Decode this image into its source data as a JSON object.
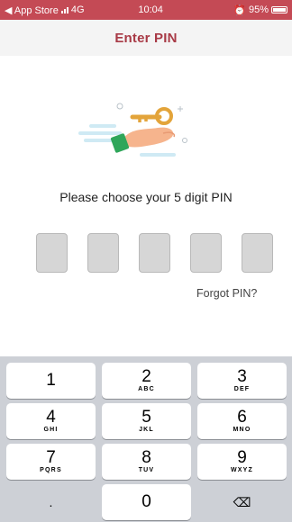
{
  "status_bar": {
    "back_app": "◀ App Store",
    "network": "4G",
    "time": "10:04",
    "battery": "95%"
  },
  "header": {
    "title": "Enter PIN"
  },
  "illustration": {
    "icon": "hand-with-key-icon",
    "key_color": "#e3a43a"
  },
  "pin": {
    "prompt": "Please choose your 5 digit PIN",
    "length": 5,
    "forgot_label": "Forgot PIN?"
  },
  "keypad": {
    "keys": [
      {
        "num": "1",
        "sub": ""
      },
      {
        "num": "2",
        "sub": "ABC"
      },
      {
        "num": "3",
        "sub": "DEF"
      },
      {
        "num": "4",
        "sub": "GHI"
      },
      {
        "num": "5",
        "sub": "JKL"
      },
      {
        "num": "6",
        "sub": "MNO"
      },
      {
        "num": "7",
        "sub": "PQRS"
      },
      {
        "num": "8",
        "sub": "TUV"
      },
      {
        "num": "9",
        "sub": "WXYZ"
      },
      {
        "num": ".",
        "sub": ""
      },
      {
        "num": "0",
        "sub": ""
      },
      {
        "num": "⌫",
        "sub": ""
      }
    ]
  },
  "colors": {
    "accent": "#a83a46",
    "status_bar": "#c44a55"
  }
}
